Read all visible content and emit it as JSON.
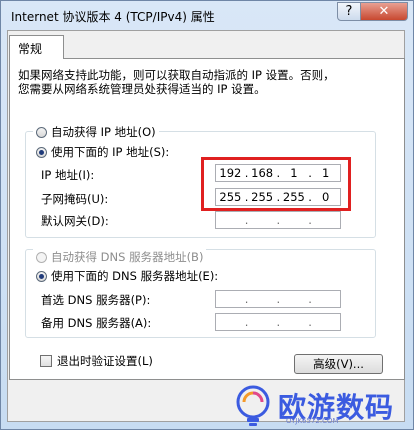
{
  "window": {
    "title": "Internet 协议版本 4 (TCP/IPv4) 属性",
    "help_glyph": "?",
    "close_glyph": "✕"
  },
  "tabs": [
    "常规"
  ],
  "description": [
    "如果网络支持此功能，则可以获取自动指派的 IP 设置。否则，",
    "您需要从网络系统管理员处获得适当的 IP 设置。"
  ],
  "ip_section": {
    "auto_label": "自动获得 IP 地址(O)",
    "manual_label": "使用下面的 IP 地址(S):",
    "selected": "manual",
    "fields": [
      {
        "label": "IP 地址(I):",
        "value": [
          "192",
          "168",
          "1",
          "1"
        ]
      },
      {
        "label": "子网掩码(U):",
        "value": [
          "255",
          "255",
          "255",
          "0"
        ]
      },
      {
        "label": "默认网关(D):",
        "value": [
          "",
          "",
          "",
          ""
        ]
      }
    ]
  },
  "dns_section": {
    "auto_label": "自动获得 DNS 服务器地址(B)",
    "manual_label": "使用下面的 DNS 服务器地址(E):",
    "selected": "manual",
    "fields": [
      {
        "label": "首选 DNS 服务器(P):",
        "value": [
          "",
          "",
          "",
          ""
        ]
      },
      {
        "label": "备用 DNS 服务器(A):",
        "value": [
          "",
          "",
          "",
          ""
        ]
      }
    ]
  },
  "validate_on_exit": {
    "label": "退出时验证设置(L)",
    "checked": false
  },
  "advanced_button": "高级(V)...",
  "colors": {
    "highlight": "#e02020",
    "accent": "#1f3a7a",
    "watermark": "#3b5be0"
  },
  "watermark": {
    "text": "欧游数码",
    "sub": "OYJK6572.COM",
    "icon": "bulb-logo-icon"
  }
}
